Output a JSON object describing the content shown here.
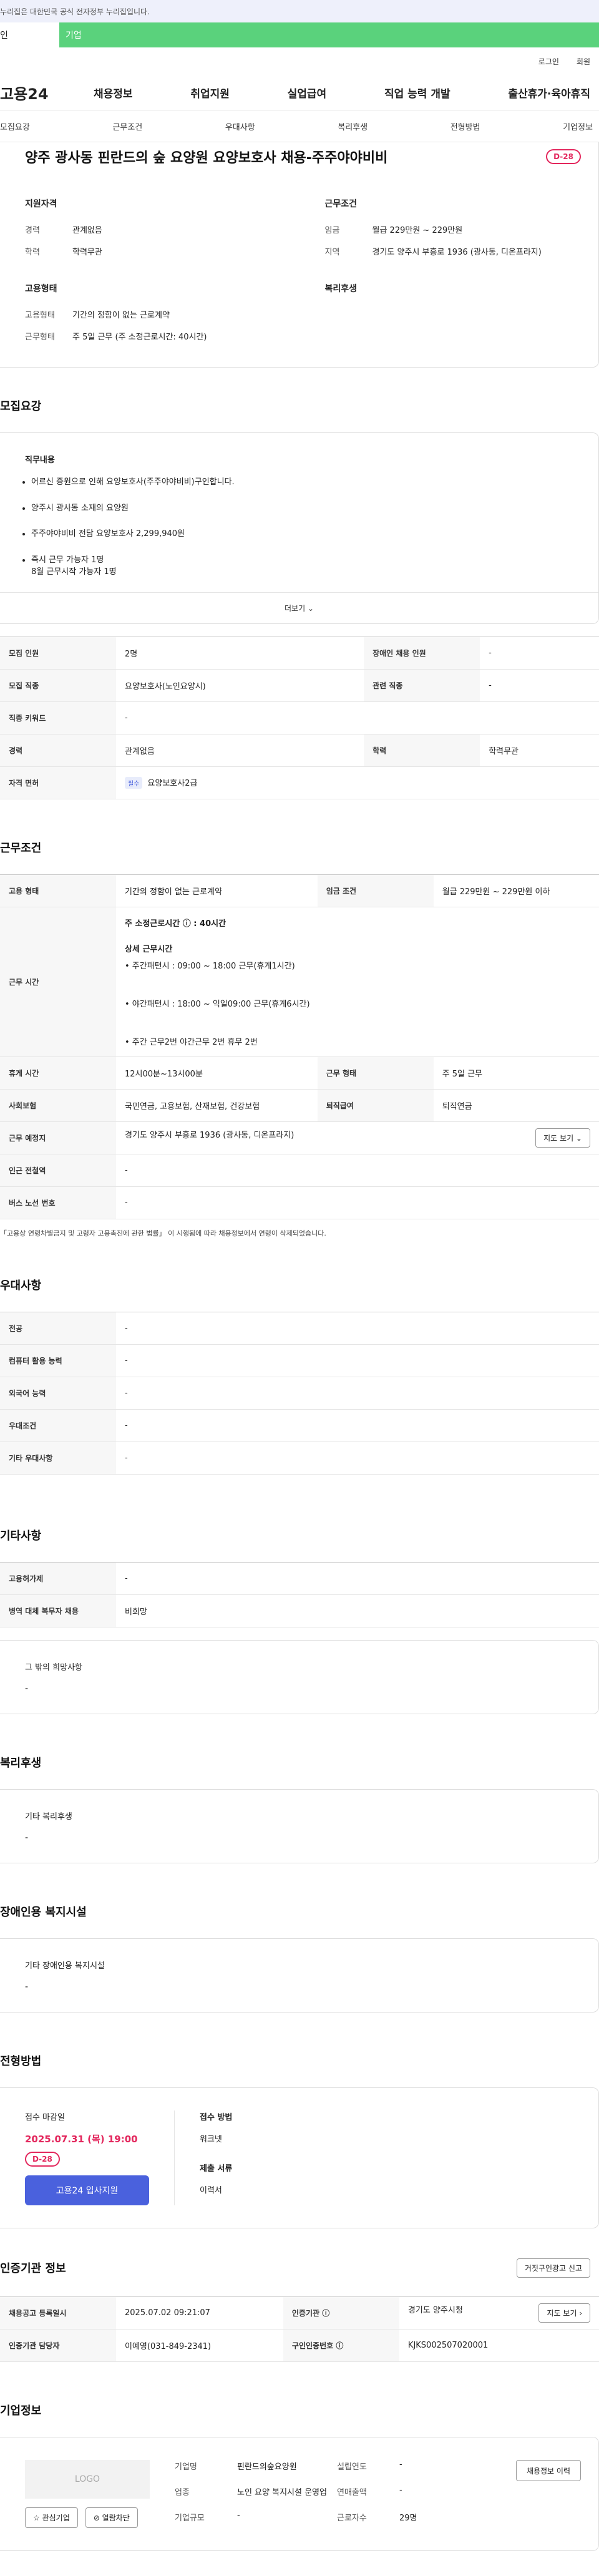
{
  "topbar": {
    "text": "누리집은 대한민국 공식 전자정부 누리집입니다."
  },
  "usertabs": {
    "personal": "인",
    "business": "기업"
  },
  "util": {
    "login": "로그인",
    "signup": "회원"
  },
  "gnb": {
    "logo": "고용24",
    "items": [
      "채용정보",
      "취업지원",
      "실업급여",
      "직업 능력 개발",
      "출산휴가·육아휴직"
    ]
  },
  "subnav": {
    "items": [
      "모집요강",
      "근무조건",
      "우대사항",
      "복리후생",
      "전형방법",
      "기업정보"
    ]
  },
  "job": {
    "title": "양주 광사동 핀란드의 숲 요양원 요양보호사 채용-주주야야비비",
    "dday": "D-28",
    "qual_title": "지원자격",
    "qual": [
      {
        "k": "경력",
        "v": "관계없음"
      },
      {
        "k": "학력",
        "v": "학력무관"
      }
    ],
    "work_title": "근무조건",
    "work": [
      {
        "k": "임금",
        "v": "월급 229만원 ~ 229만원"
      },
      {
        "k": "지역",
        "v": "경기도 양주시 부흥로 1936 (광사동, 디온프라지)"
      }
    ],
    "emp_title": "고용형태",
    "emp": [
      {
        "k": "고용형태",
        "v": "기간의 정함이 없는 근로계약"
      },
      {
        "k": "근무형태",
        "v": "주 5일 근무 (주 소정근로시간: 40시간)"
      }
    ],
    "welfare_title": "복리후생"
  },
  "recruit": {
    "section_title": "모집요강",
    "duty_title": "직무내용",
    "duties": [
      "어르신 증원으로 인해 요양보호사(주주야야비비)구인합니다.",
      "양주시 광사동 소재의 요양원",
      "주주야야비비 전담 요양보호사 2,299,940원",
      "즉시 근무 가능자 1명"
    ],
    "duty_sub": "8월 근무시작 가능자 1명",
    "more": "더보기 ⌄",
    "rows": {
      "headcount_k": "모집 인원",
      "headcount_v": "2명",
      "disabled_k": "장애인 채용 인원",
      "disabled_v": "-",
      "job_k": "모집 직종",
      "job_v": "요양보호사(노인요양시)",
      "related_k": "관련 직종",
      "related_v": "-",
      "keyword_k": "직종 키워드",
      "keyword_v": "-",
      "career_k": "경력",
      "career_v": "관계없음",
      "edu_k": "학력",
      "edu_v": "학력무관",
      "license_k": "자격 면허",
      "license_badge": "필수",
      "license_v": "요양보호사2급"
    }
  },
  "conditions": {
    "section_title": "근무조건",
    "emp_k": "고용 형태",
    "emp_v": "기간의 정함이 없는 근로계약",
    "wage_k": "임금 조건",
    "wage_v": "월급 229만원 ~ 229만원 이하",
    "hours_k": "근무 시간",
    "hours_main": "주 소정근로시간 ⓘ : 40시간",
    "hours_detail_title": "상세 근무시간",
    "hours_lines": [
      "• 주간패턴시 : 09:00 ~ 18:00 근무(휴게1시간)",
      "• 야간패턴시 : 18:00 ~ 익일09:00 근무(휴게6시간)",
      "• 주간 근무2번 야간근무 2번 휴무 2번"
    ],
    "break_k": "휴게 시간",
    "break_v": "12시00분~13시00분",
    "shift_k": "근무 형태",
    "shift_v": "주 5일 근무",
    "insurance_k": "사회보험",
    "insurance_v": "국민연금, 고용보험, 산재보험, 건강보험",
    "retire_k": "퇴직급여",
    "retire_v": "퇴직연금",
    "place_k": "근무 예정지",
    "place_v": "경기도 양주시 부흥로 1936 (광사동, 디온프라지)",
    "map_btn": "지도 보기 ⌄",
    "station_k": "인근 전철역",
    "station_v": "-",
    "bus_k": "버스 노선 번호",
    "bus_v": "-",
    "note": "「고용상 연령차별금지 및 고령자 고용촉진에 관한 법률」 이 시행됨에 따라 채용정보에서 연령이 삭제되었습니다."
  },
  "preference": {
    "section_title": "우대사항",
    "rows": [
      {
        "k": "전공",
        "v": "-"
      },
      {
        "k": "컴퓨터 활용 능력",
        "v": "-"
      },
      {
        "k": "외국어 능력",
        "v": "-"
      },
      {
        "k": "우대조건",
        "v": "-"
      },
      {
        "k": "기타 우대사항",
        "v": "-"
      }
    ]
  },
  "etc": {
    "section_title": "기타사항",
    "rows": [
      {
        "k": "고용허가제",
        "v": "-"
      },
      {
        "k": "병역 대체 복무자 채용",
        "v": "비희망"
      }
    ],
    "extra_title": "그 밖의 희망사항",
    "extra_v": "-"
  },
  "welfare": {
    "section_title": "복리후생",
    "card_title": "기타 복리후생",
    "card_v": "-"
  },
  "disabled": {
    "section_title": "장애인용 복지시설",
    "card_title": "기타 장애인용 복지시설",
    "card_v": "-"
  },
  "apply": {
    "section_title": "전형방법",
    "deadline_label": "접수 마감일",
    "deadline": "2025.07.31 (목) 19:00",
    "dday": "D-28",
    "apply_btn": "고용24 입사지원",
    "method_label": "접수 방법",
    "method_v": "워크넷",
    "docs_label": "제출 서류",
    "docs_v": "이력서"
  },
  "agency": {
    "section_title": "인증기관 정보",
    "report_btn": "거짓구인광고 신고",
    "reg_k": "채용공고 등록일시",
    "reg_v": "2025.07.02 09:21:07",
    "org_k": "인증기관 ⓘ",
    "org_v": "경기도 양주시청",
    "map_btn": "지도 보기 ›",
    "manager_k": "인증기관 담당자",
    "manager_v": "이예영(031-849-2341)",
    "cert_k": "구인인증번호 ⓘ",
    "cert_v": "KJKS002507020001"
  },
  "company": {
    "section_title": "기업정보",
    "logo": "LOGO",
    "fav_btn": "☆ 관심기업",
    "block_btn": "⊘ 열람차단",
    "name_k": "기업명",
    "name_v": "핀란드의숲요양원",
    "founded_k": "설립연도",
    "founded_v": "-",
    "industry_k": "업종",
    "industry_v": "노인 요양 복지시설 운영업",
    "sales_k": "연매출액",
    "sales_v": "-",
    "size_k": "기업규모",
    "size_v": "-",
    "staff_k": "근로자수",
    "staff_v": "29명",
    "history_btn": "채용정보 이력"
  }
}
